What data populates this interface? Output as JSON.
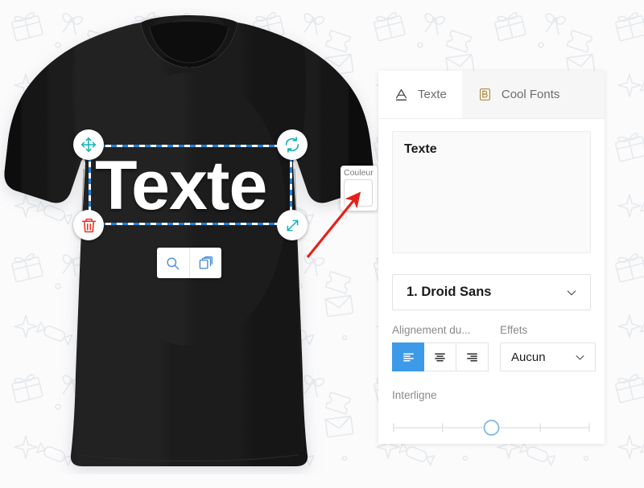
{
  "canvas": {
    "product": "black-tshirt-mockup",
    "artwork_text": "Texte",
    "artwork_text_color": "#ffffff",
    "selection": {
      "handles": [
        {
          "name": "move-handle",
          "icon": "move-arrows-icon",
          "color": "#16b3b8"
        },
        {
          "name": "rotate-handle",
          "icon": "rotate-icon",
          "color": "#16b3b8"
        },
        {
          "name": "delete-handle",
          "icon": "trash-icon",
          "color": "#ea3323"
        },
        {
          "name": "resize-handle",
          "icon": "resize-diagonal-icon",
          "color": "#16b3b8"
        }
      ],
      "border_color": "#1a84e0"
    },
    "mini_toolbar": [
      {
        "name": "zoom-button",
        "icon": "magnifier-icon",
        "color": "#4a90d9"
      },
      {
        "name": "duplicate-button",
        "icon": "layers-copy-icon",
        "color": "#4a90d9"
      }
    ],
    "color_tooltip": {
      "label": "Couleur",
      "swatch_color": "#ffffff"
    },
    "annotation_arrow_color": "#e8201a"
  },
  "panel": {
    "tabs": [
      {
        "label": "Texte",
        "icon": "letter-a-underline-icon",
        "active": true
      },
      {
        "label": "Cool Fonts",
        "icon": "letter-b-outline-icon",
        "active": false
      }
    ],
    "text_input": {
      "value": "Texte",
      "placeholder": "Texte"
    },
    "font": {
      "label": "",
      "selected": "1. Droid Sans",
      "chevron": "chevron-down-icon"
    },
    "alignment": {
      "label": "Alignement du...",
      "options": [
        {
          "name": "align-left",
          "icon": "align-left-icon",
          "selected": true
        },
        {
          "name": "align-center",
          "icon": "align-center-icon",
          "selected": false
        },
        {
          "name": "align-right",
          "icon": "align-right-icon",
          "selected": false
        }
      ],
      "active_color": "#3d9ae8"
    },
    "effects": {
      "label": "Effets",
      "selected": "Aucun",
      "chevron": "chevron-down-icon"
    },
    "line_height": {
      "label": "Interligne",
      "value": 50,
      "min": 0,
      "max": 100,
      "ticks": 5,
      "handle_color": "#7fb6e0"
    }
  }
}
